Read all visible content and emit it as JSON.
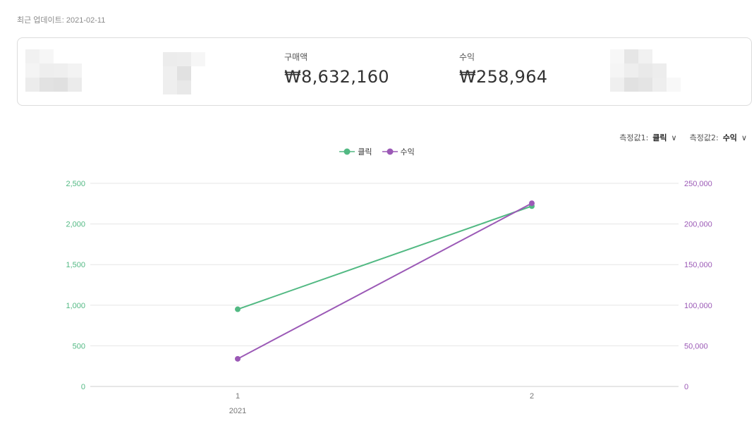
{
  "header": {
    "last_update": "최근 업데이트: 2021-02-11"
  },
  "summary": [
    {
      "label": "구매액",
      "value": "₩8,632,160"
    },
    {
      "label": "수익",
      "value": "₩258,964"
    }
  ],
  "controls": {
    "measure1_label": "측정값1:",
    "measure1_value": "클릭",
    "measure2_label": "측정값2:",
    "measure2_value": "수익"
  },
  "colors": {
    "clicks": "#52b983",
    "revenue": "#9b59b6",
    "grid": "#e6e6e6"
  },
  "chart_data": {
    "type": "line",
    "x": [
      "1",
      "2"
    ],
    "x_group_label": "2021",
    "series": [
      {
        "name": "클릭",
        "axis": "left",
        "values": [
          950,
          2220
        ]
      },
      {
        "name": "수익",
        "axis": "right",
        "values": [
          34000,
          225500
        ]
      }
    ],
    "y_left": {
      "lim": [
        0,
        2500
      ],
      "ticks": [
        "0",
        "500",
        "1,000",
        "1,500",
        "2,000",
        "2,500"
      ]
    },
    "y_right": {
      "lim": [
        0,
        250000
      ],
      "ticks": [
        "0",
        "50,000",
        "100,000",
        "150,000",
        "200,000",
        "250,000"
      ]
    },
    "legend_position": "top-center",
    "grid": true
  }
}
